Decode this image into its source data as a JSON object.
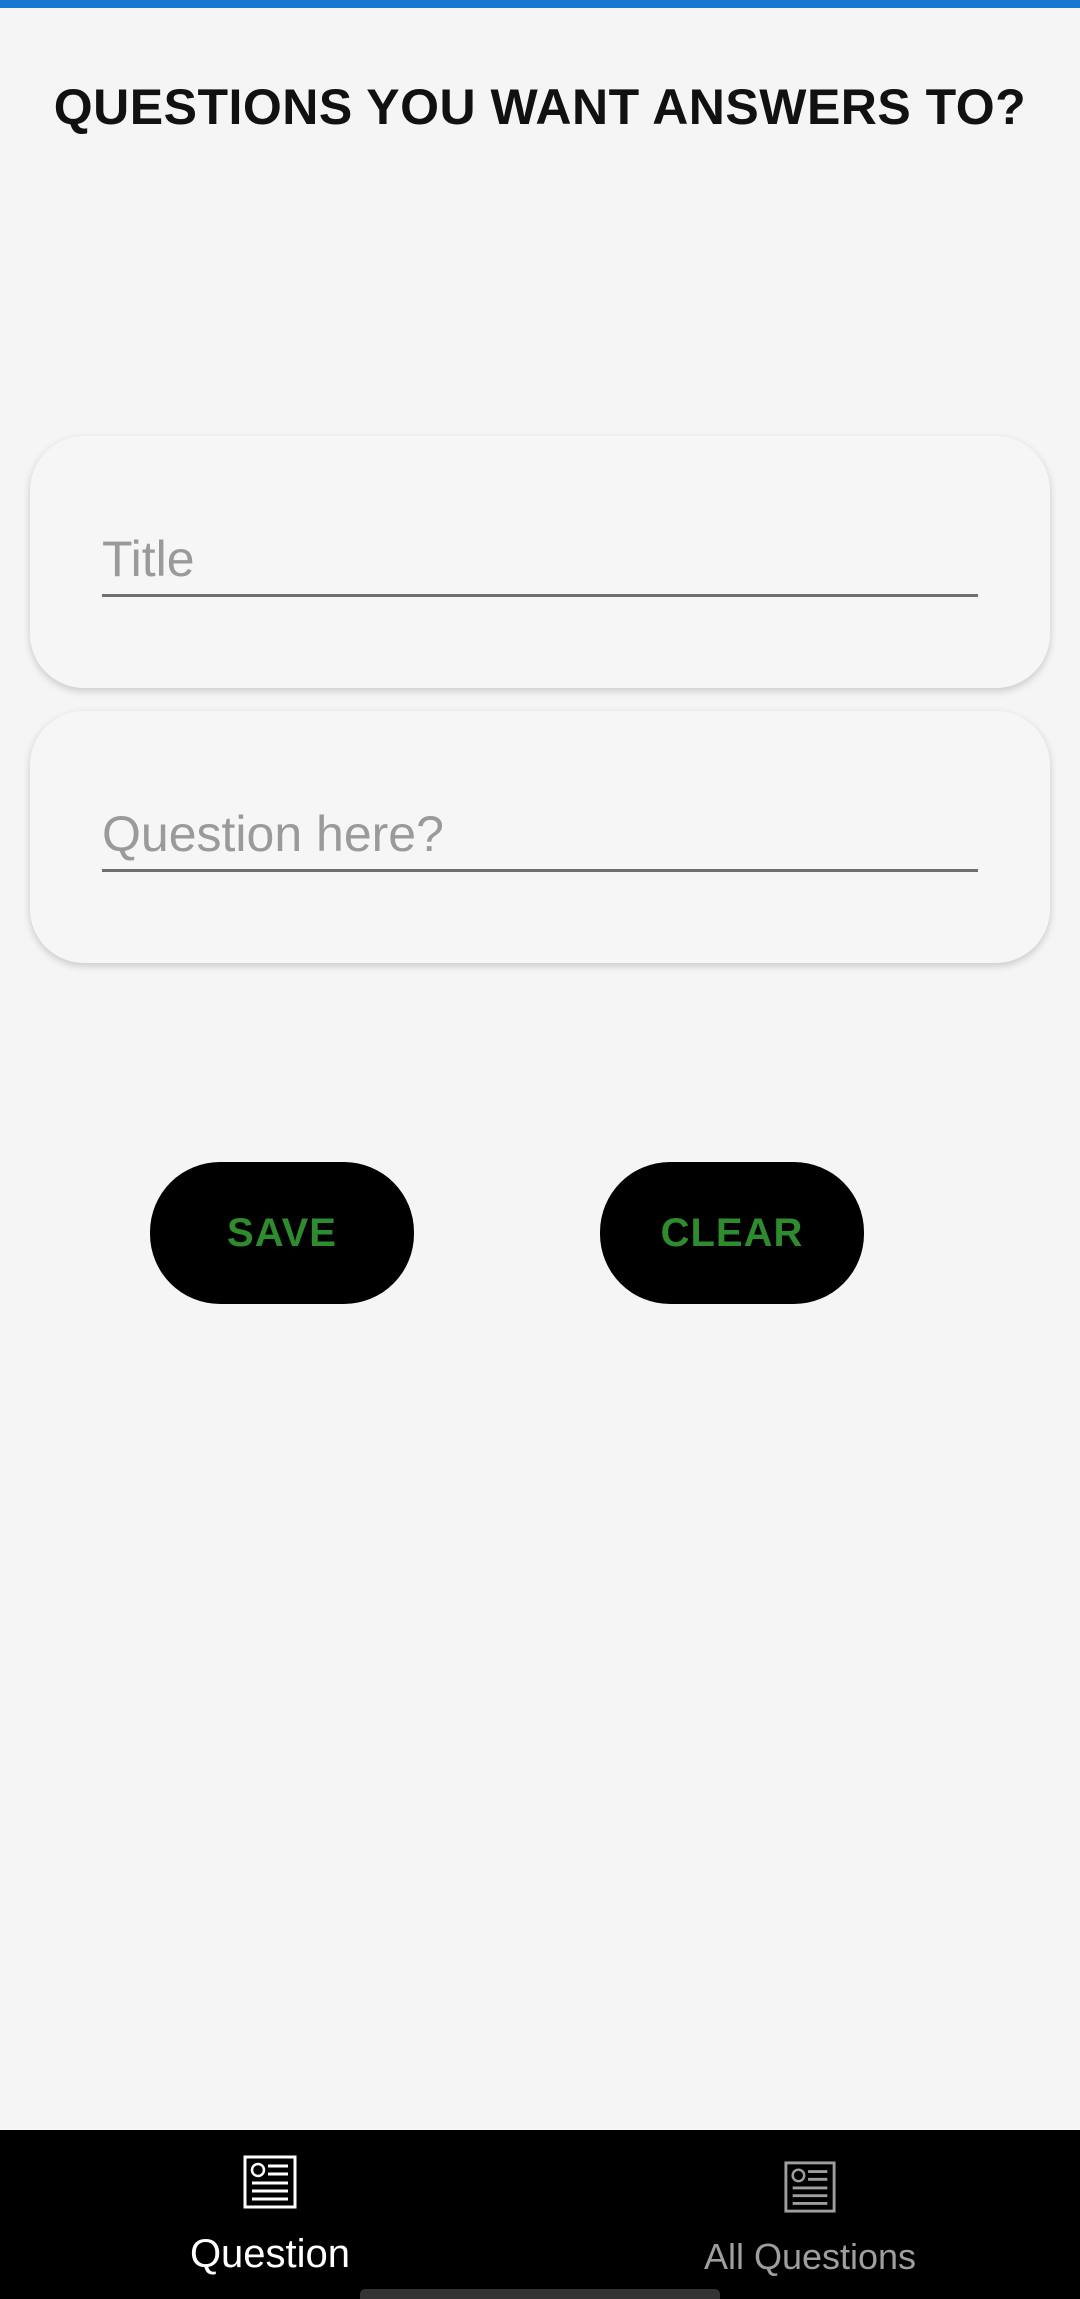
{
  "header": {
    "title": "QUESTIONS YOU WANT ANSWERS TO?"
  },
  "form": {
    "title_field": {
      "value": "",
      "placeholder": "Title"
    },
    "question_field": {
      "value": "",
      "placeholder": "Question here?"
    }
  },
  "actions": {
    "save_label": "SAVE",
    "clear_label": "CLEAR"
  },
  "bottom_nav": {
    "items": [
      {
        "label": "Question",
        "icon": "newspaper-icon",
        "selected": true
      },
      {
        "label": "All Questions",
        "icon": "newspaper-icon",
        "selected": false
      }
    ]
  },
  "colors": {
    "accent_bar": "#1976d2",
    "button_bg": "#000000",
    "button_text": "#2e8b2e",
    "nav_bg": "#000000",
    "nav_active": "#ffffff",
    "nav_inactive": "#9e9e9e"
  }
}
